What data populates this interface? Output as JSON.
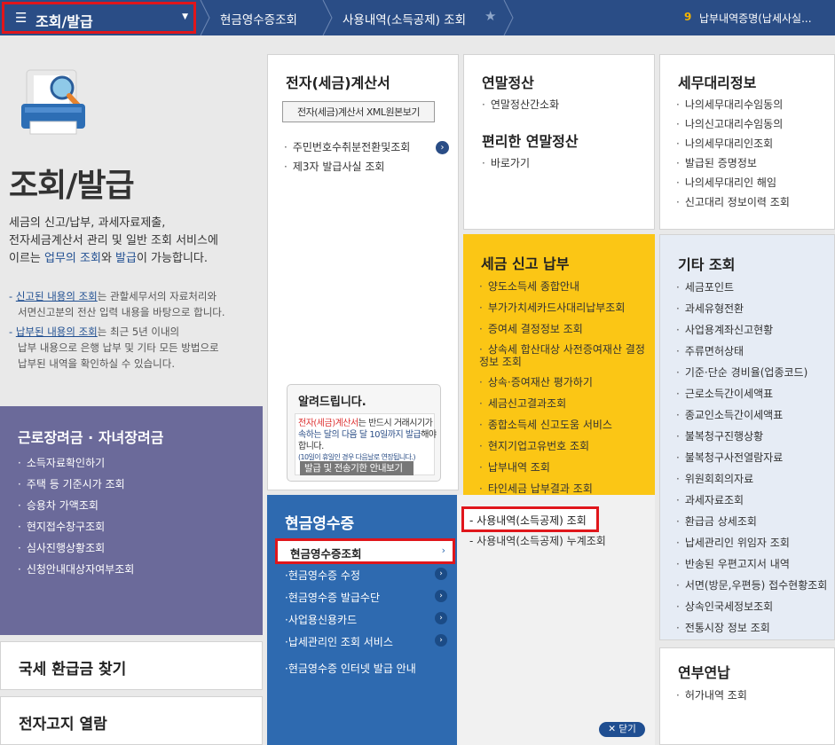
{
  "topbar": {
    "menu_icon": "hamburger-icon",
    "menu_label": "조회/발급",
    "crumb1": "현금영수증조회",
    "crumb2": "사용내역(소득공제) 조회",
    "recent_num": "9",
    "recent_text": "납부내역증명(납세사실...",
    "colors": {
      "bar": "#2a4d86",
      "highlight": "#e0161b"
    }
  },
  "hero": {
    "title": "조회/발급",
    "desc_1": "세금의 신고/납부, 과세자료제출,",
    "desc_2": "전자세금계산서 관리 및 일반 조회 서비스에",
    "desc_3a": "이르는 ",
    "desc_3b": "업무의 조회",
    "desc_3c": "와 ",
    "desc_3d": "발급",
    "desc_3e": "이 가능합니다.",
    "note1_a": "신고된 내용의 조회",
    "note1_b": "는 관할세무서의 자료처리와",
    "note1_c": "서면신고분의 전산 입력 내용을 바탕으로 합니다.",
    "note2_a": "납부된 내용의 조회",
    "note2_b": "는 최근 5년 이내의",
    "note2_c": "납부 내용으로 은행 납부 및 기타 모든 방법으로",
    "note2_d": "납부된 내역을 확인하실 수 있습니다."
  },
  "work": {
    "title": "근로장려금 · 자녀장려금",
    "items": [
      "소득자료확인하기",
      "주택 등 기준시가 조회",
      "승용차 가액조회",
      "현지접수창구조회",
      "심사진행상황조회",
      "신청안내대상자여부조회"
    ]
  },
  "refund": {
    "title": "국세 환급금 찾기"
  },
  "enotice": {
    "title": "전자고지 열람"
  },
  "einvoice": {
    "title": "전자(세금)계산서",
    "xml_button": "전자(세금)계산서 XML원본보기",
    "items": [
      "주민번호수취분전환및조회",
      "제3자 발급사실 조회"
    ],
    "notice_title": "알려드립니다.",
    "notice_red": "전자(세금)계산서",
    "notice_text1": "는 반드시 거래시기가 ",
    "notice_blue": "속하는 달의 다음 달 10일까지 발급",
    "notice_text2": "해야 합니다.",
    "notice_small": "(10일이 휴일인 경우 다음날로 연장됩니다.)",
    "notice_button": "발급 및 전송기한 안내보기"
  },
  "yearend": {
    "title": "연말정산",
    "items": [
      "연말정산간소화"
    ],
    "title2": "편리한 연말정산",
    "items2": [
      "바로가기"
    ]
  },
  "taxagent": {
    "title": "세무대리정보",
    "items": [
      "나의세무대리수임동의",
      "나의신고대리수임동의",
      "나의세무대리인조회",
      "발급된 증명정보",
      "나의세무대리인 해임",
      "신고대리 정보이력 조회"
    ]
  },
  "report": {
    "title": "세금 신고 납부",
    "items": [
      "양도소득세 종합안내",
      "부가가치세카드사대리납부조회",
      "증여세 결정정보 조회",
      "상속세 합산대상 사전증여재산 결정정보 조회",
      "상속·증여재산 평가하기",
      "세금신고결과조회",
      "종합소득세 신고도움 서비스",
      "현지기업고유번호 조회",
      "납부내역 조회",
      "타인세금 납부결과 조회"
    ]
  },
  "etc": {
    "title": "기타 조회",
    "items": [
      "세금포인트",
      "과세유형전환",
      "사업용계좌신고현황",
      "주류면허상태",
      "기준·단순 경비율(업종코드)",
      "근로소득간이세액표",
      "종교인소득간이세액표",
      "불복청구진행상황",
      "불복청구사전열람자료",
      "위원회회의자료",
      "과세자료조회",
      "환급금 상세조회",
      "납세관리인 위임자 조회",
      "반송된 우편고지서 내역",
      "서면(방문,우편등) 접수현황조회",
      "상속인국세정보조회",
      "전통시장 정보 조회"
    ]
  },
  "transfer": {
    "title": "연부연납",
    "items": [
      "허가내역 조회"
    ]
  },
  "cash": {
    "title": "현금영수증",
    "active": "현금영수증조회",
    "items": [
      "현금영수증 수정",
      "현금영수증 발급수단",
      "사업용신용카드",
      "납세관리인 조회 서비스",
      "현금영수증 인터넷 발급 안내"
    ],
    "sub_active": "사용내역(소득공제) 조회",
    "sub_2": "사용내역(소득공제) 누계조회",
    "close": "닫기"
  }
}
